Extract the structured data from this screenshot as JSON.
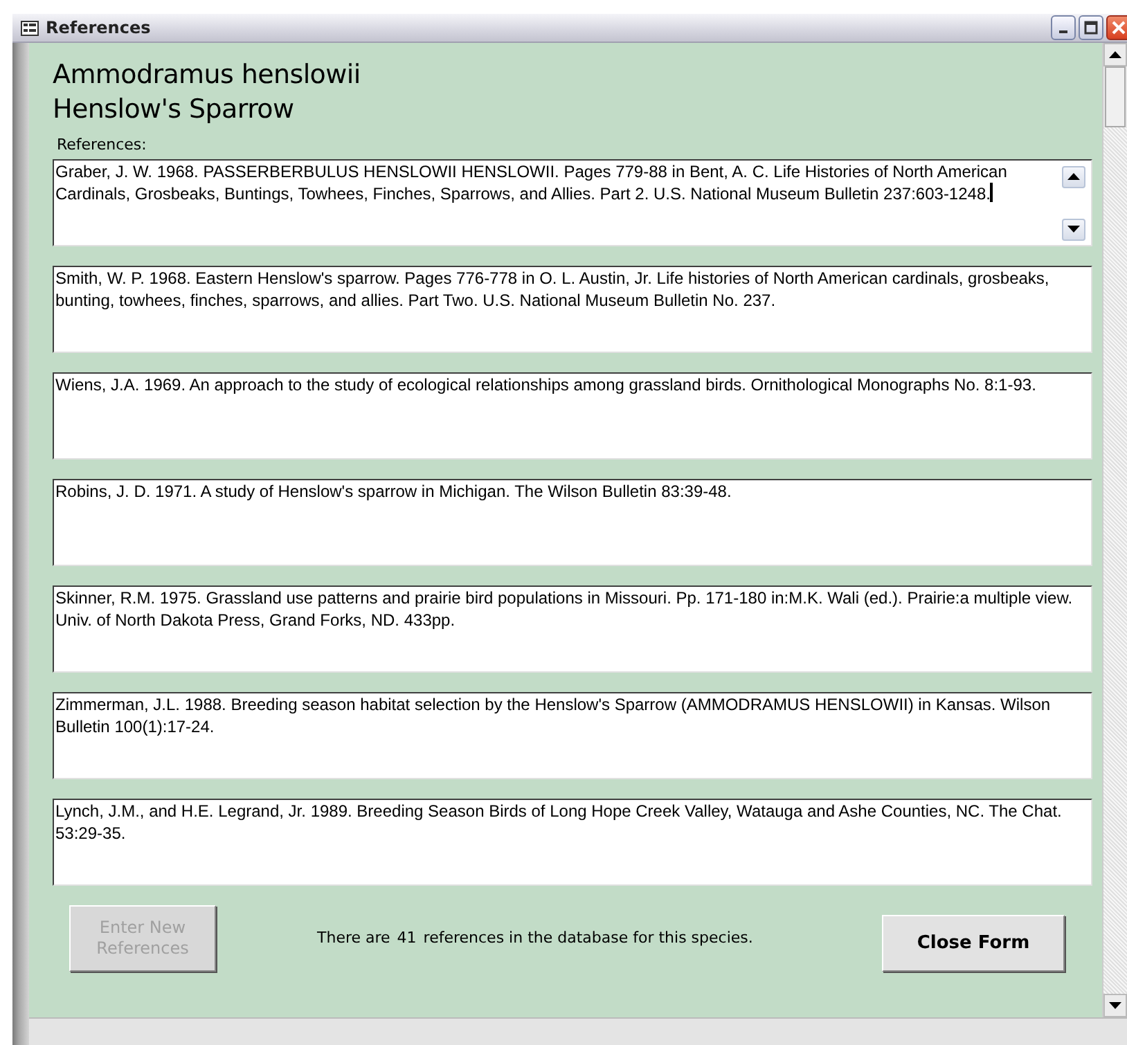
{
  "window": {
    "title": "References"
  },
  "species": {
    "scientific_name": "Ammodramus henslowii",
    "common_name": "Henslow's Sparrow"
  },
  "references_label": "References:",
  "references": [
    {
      "text": "Graber, J. W. 1968. PASSERBERBULUS HENSLOWII HENSLOWII. Pages 779-88 in Bent, A. C. Life Histories of North American Cardinals, Grosbeaks, Buntings, Towhees, Finches, Sparrows, and Allies. Part 2. U.S. National Museum Bulletin 237:603-1248.",
      "focused": true
    },
    {
      "text": "Smith, W. P. 1968. Eastern Henslow's sparrow. Pages 776-778 in O. L. Austin, Jr. Life histories of North American cardinals, grosbeaks, bunting, towhees, finches, sparrows, and allies. Part Two. U.S. National Museum Bulletin No. 237.",
      "focused": false
    },
    {
      "text": "Wiens, J.A. 1969. An approach to the study of ecological relationships among grassland birds. Ornithological Monographs No. 8:1-93.",
      "focused": false
    },
    {
      "text": "Robins, J. D. 1971. A study of Henslow's sparrow in Michigan. The Wilson Bulletin 83:39-48.",
      "focused": false
    },
    {
      "text": "Skinner, R.M. 1975. Grassland use patterns and prairie bird populations in Missouri. Pp. 171-180 in:M.K. Wali (ed.). Prairie:a multiple view. Univ. of North Dakota Press, Grand Forks, ND. 433pp.",
      "focused": false
    },
    {
      "text": "Zimmerman, J.L. 1988. Breeding season habitat selection by the Henslow's Sparrow (AMMODRAMUS HENSLOWII) in Kansas. Wilson Bulletin 100(1):17-24.",
      "focused": false
    },
    {
      "text": "Lynch, J.M., and H.E. Legrand, Jr. 1989. Breeding Season Birds of Long Hope Creek Valley, Watauga and Ashe Counties, NC. The Chat. 53:29-35.",
      "focused": false
    }
  ],
  "footer": {
    "enter_button": {
      "label": "Enter New References",
      "disabled": true
    },
    "count_prefix": "There are",
    "count": "41",
    "count_suffix": "references in the database for this species.",
    "close_button": {
      "label": "Close Form",
      "disabled": false
    }
  }
}
